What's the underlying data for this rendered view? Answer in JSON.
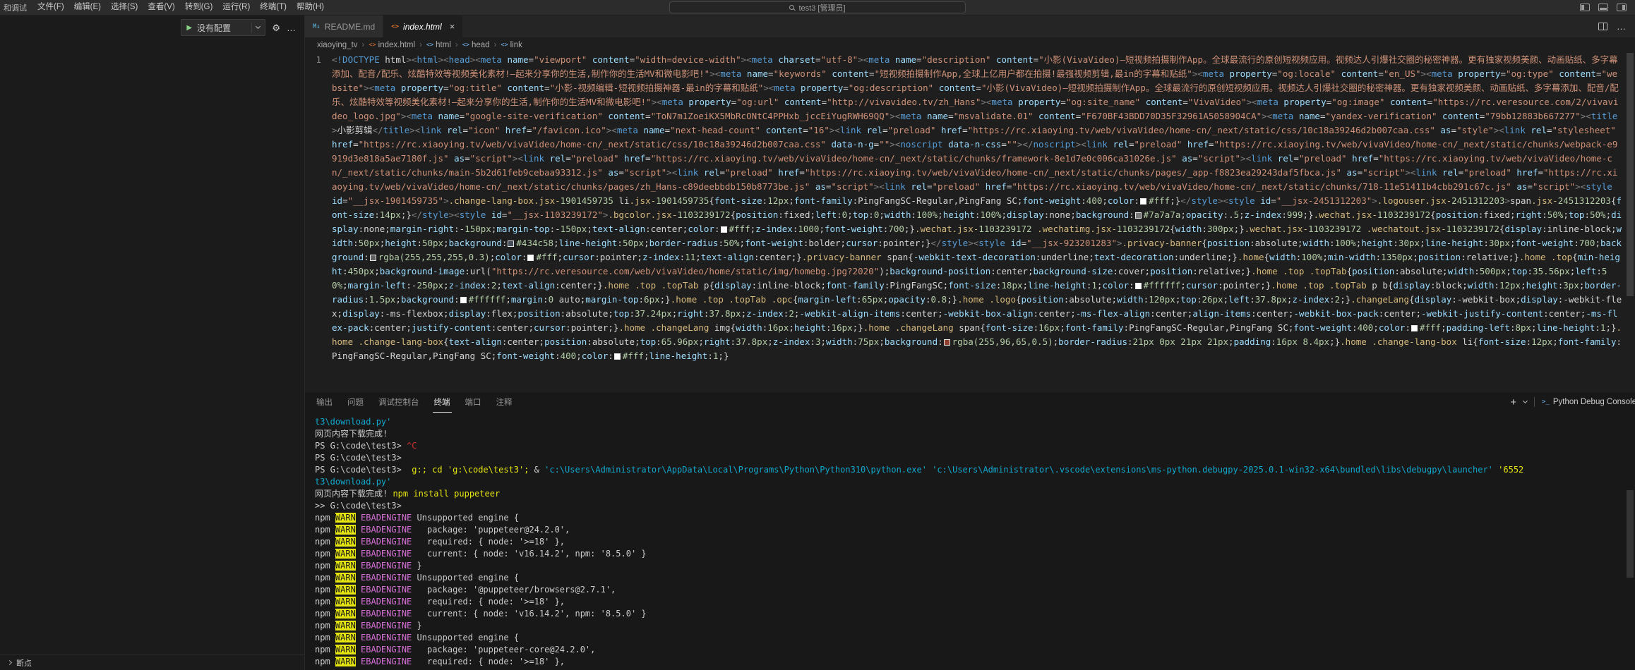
{
  "titlebar": {
    "sidebar_title_partial": "和调试",
    "menus": [
      "文件(F)",
      "编辑(E)",
      "选择(S)",
      "查看(V)",
      "转到(G)",
      "运行(R)",
      "终端(T)",
      "帮助(H)"
    ],
    "command_center": "test3 [管理员]"
  },
  "sidebar": {
    "run_config": "没有配置",
    "bottom_section": "断点"
  },
  "editor": {
    "tabs": [
      {
        "label": "README.md",
        "icon": "md",
        "active": false,
        "preview": false
      },
      {
        "label": "index.html",
        "icon": "html",
        "active": true,
        "preview": true
      }
    ],
    "breadcrumb": [
      "xiaoying_tv",
      "index.html",
      "html",
      "head",
      "link"
    ],
    "line_number": "1",
    "code": "<!DOCTYPE html><html><head><meta name=\"viewport\" content=\"width=device-width\"><meta charset=\"utf-8\"><meta name=\"description\" content=\"小影(VivaVideo)—短视频拍摄制作App。全球最流行的原创短视频应用。视频达人引爆社交圈的秘密神器。更有独家视频美颜、动画贴纸、多字幕添加、配音/配乐、炫酷特效等视频美化素材!—起来分享你的生活,制作你的生活MV和微电影吧!\"><meta name=\"keywords\" content=\"短视频拍摄制作App,全球上亿用户都在拍摄!最强视频剪辑,最in的字幕和贴纸\"><meta property=\"og:locale\" content=\"en_US\"><meta property=\"og:type\" content=\"website\"><meta property=\"og:title\" content=\"小影-视频编辑-短视频拍摄神器-最in的字幕和贴纸\"><meta property=\"og:description\" content=\"小影(VivaVideo)—短视频拍摄制作App。全球最流行的原创短视频应用。视频达人引爆社交圈的秘密神器。更有独家视频美颜、动画贴纸、多字幕添加、配音/配乐、炫酷特效等视频美化素材!—起来分享你的生活,制作你的生活MV和微电影吧!\"><meta property=\"og:url\" content=\"http://vivavideo.tv/zh_Hans\"><meta property=\"og:site_name\" content=\"VivaVideo\"><meta property=\"og:image\" content=\"https://rc.veresource.com/2/vivavideo_logo.jpg\"><meta name=\"google-site-verification\" content=\"ToN7m1ZoeiKX5MbRcONtC4PPHxb_jccEiYugRWH69QQ\"><meta name=\"msvalidate.01\" content=\"F670BF43BDD70D35F32961A5058904CA\"><meta name=\"yandex-verification\" content=\"79bb12883b667277\"><title>小影剪辑</title><link rel=\"icon\" href=\"/favicon.ico\"><meta name=\"next-head-count\" content=\"16\"><link rel=\"preload\" href=\"https://rc.xiaoying.tv/web/vivaVideo/home-cn/_next/static/css/10c18a39246d2b007caa.css\" as=\"style\"><link rel=\"stylesheet\" href=\"https://rc.xiaoying.tv/web/vivaVideo/home-cn/_next/static/css/10c18a39246d2b007caa.css\" data-n-g=\"\"><noscript data-n-css=\"\"></noscript><link rel=\"preload\" href=\"https://rc.xiaoying.tv/web/vivaVideo/home-cn/_next/static/chunks/webpack-e9919d3e818a5ae7180f.js\" as=\"script\"><link rel=\"preload\" href=\"https://rc.xiaoying.tv/web/vivaVideo/home-cn/_next/static/chunks/framework-8e1d7e0c006ca31026e.js\" as=\"script\"><link rel=\"preload\" href=\"https://rc.xiaoying.tv/web/vivaVideo/home-cn/_next/static/chunks/main-5b2d61feb9cebaa93312.js\" as=\"script\"><link rel=\"preload\" href=\"https://rc.xiaoying.tv/web/vivaVideo/home-cn/_next/static/chunks/pages/_app-f8823ea29243daf5fbca.js\" as=\"script\"><link rel=\"preload\" href=\"https://rc.xiaoying.tv/web/vivaVideo/home-cn/_next/static/chunks/pages/zh_Hans-c89deebbdb150b8773be.js\" as=\"script\"><link rel=\"preload\" href=\"https://rc.xiaoying.tv/web/vivaVideo/home-cn/_next/static/chunks/718-11e51411b4cbb291c67c.js\" as=\"script\"><style id=\"__jsx-1901459735\">.change-lang-box.jsx-1901459735 li.jsx-1901459735{font-size:12px;font-family:PingFangSC-Regular,PingFang SC;font-weight:400;color:#fff;}</style><style id=\"__jsx-2451312203\">.logouser.jsx-2451312203>span.jsx-2451312203{font-size:14px;}</style><style id=\"__jsx-1103239172\">.bgcolor.jsx-1103239172{position:fixed;left:0;top:0;width:100%;height:100%;display:none;background:#7a7a7a;opacity:.5;z-index:999;}.wechat.jsx-1103239172{position:fixed;right:50%;top:50%;display:none;margin-right:-150px;margin-top:-150px;text-align:center;color:#fff;z-index:1000;font-weight:700;}.wechat.jsx-1103239172 .wechatimg.jsx-1103239172{width:300px;}.wechat.jsx-1103239172 .wechatout.jsx-1103239172{display:inline-block;width:50px;height:50px;background:#434c58;line-height:50px;border-radius:50%;font-weight:bolder;cursor:pointer;}</style><style id=\"__jsx-923201283\">.privacy-banner{position:absolute;width:100%;height:30px;line-height:30px;font-weight:700;background:rgba(255,255,255,0.3);color:#fff;cursor:pointer;z-index:11;text-align:center;}.privacy-banner span{-webkit-text-decoration:underline;text-decoration:underline;}.home{width:100%;min-width:1350px;position:relative;}.home .top{min-height:450px;background-image:url(\"https://rc.veresource.com/web/vivaVideo/home/static/img/homebg.jpg?2020\");background-position:center;background-size:cover;position:relative;}.home .top .topTab{position:absolute;width:500px;top:35.56px;left:50%;margin-left:-250px;z-index:2;text-align:center;}.home .top .topTab p{display:inline-block;font-family:PingFangSC;font-size:18px;line-height:1;color:#ffffff;cursor:pointer;}.home .top .topTab p b{display:block;width:12px;height:3px;border-radius:1.5px;background:#ffffff;margin:0 auto;margin-top:6px;}.home .top .topTab .opc{margin-left:65px;opacity:0.8;}.home .logo{position:absolute;width:120px;top:26px;left:37.8px;z-index:2;}.changeLang{display:-webkit-box;display:-webkit-flex;display:-ms-flexbox;display:flex;position:absolute;top:37.24px;right:37.8px;z-index:2;-webkit-align-items:center;-webkit-box-align:center;-ms-flex-align:center;align-items:center;-webkit-box-pack:center;-webkit-justify-content:center;-ms-flex-pack:center;justify-content:center;cursor:pointer;}.home .changeLang img{width:16px;height:16px;}.home .changeLang span{font-size:16px;font-family:PingFangSC-Regular,PingFang SC;font-weight:400;color:#fff;padding-left:8px;line-height:1;}.home .change-lang-box{text-align:center;position:absolute;top:65.96px;right:37.8px;z-index:3;width:75px;background:rgba(255,96,65,0.5);border-radius:21px 0px 21px 21px;padding:16px 8.4px;}.home .change-lang-box li{font-size:12px;font-family:PingFangSC-Regular,PingFang SC;font-weight:400;color:#fff;line-height:1;}"
  },
  "panel": {
    "tabs": [
      "输出",
      "问题",
      "调试控制台",
      "终端",
      "端口",
      "注释"
    ],
    "active_tab": "终端",
    "terminal_list_item": "Python Debug Console",
    "terminal_lines": [
      [
        [
          "c",
          "t3\\download.py'"
        ]
      ],
      [
        [
          "d",
          "网页内容下载完成!"
        ]
      ],
      [
        [
          "d",
          "PS G:\\code\\test3> "
        ],
        [
          "r",
          "^C"
        ]
      ],
      [
        [
          "d",
          "PS G:\\code\\test3> "
        ]
      ],
      [
        [
          "d",
          "PS G:\\code\\test3>  "
        ],
        [
          "y",
          "g:; cd 'g:\\code\\test3'; "
        ],
        [
          "d",
          "& "
        ],
        [
          "c",
          "'c:\\Users\\Administrator\\AppData\\Local\\Programs\\Python\\Python310\\python.exe' "
        ],
        [
          "c",
          "'c:\\Users\\Administrator\\.vscode\\extensions\\ms-python.debugpy-2025.0.1-win32-x64\\bundled\\libs\\debugpy\\launcher' "
        ],
        [
          "y",
          "'6552"
        ]
      ],
      [
        [
          "c",
          "t3\\download.py'"
        ]
      ],
      [
        [
          "d",
          "网页内容下载完成! "
        ],
        [
          "y",
          "npm install puppeteer"
        ]
      ],
      [
        [
          "d",
          ">> G:\\code\\test3>"
        ]
      ],
      [
        [
          "d",
          "npm "
        ],
        [
          "w",
          "WARN"
        ],
        [
          "m",
          " EBADENGINE"
        ],
        [
          "d",
          " Unsupported engine {"
        ]
      ],
      [
        [
          "d",
          "npm "
        ],
        [
          "w",
          "WARN"
        ],
        [
          "m",
          " EBADENGINE"
        ],
        [
          "d",
          "   package: 'puppeteer@24.2.0',"
        ]
      ],
      [
        [
          "d",
          "npm "
        ],
        [
          "w",
          "WARN"
        ],
        [
          "m",
          " EBADENGINE"
        ],
        [
          "d",
          "   required: { node: '>=18' },"
        ]
      ],
      [
        [
          "d",
          "npm "
        ],
        [
          "w",
          "WARN"
        ],
        [
          "m",
          " EBADENGINE"
        ],
        [
          "d",
          "   current: { node: 'v16.14.2', npm: '8.5.0' }"
        ]
      ],
      [
        [
          "d",
          "npm "
        ],
        [
          "w",
          "WARN"
        ],
        [
          "m",
          " EBADENGINE"
        ],
        [
          "d",
          " }"
        ]
      ],
      [
        [
          "d",
          "npm "
        ],
        [
          "w",
          "WARN"
        ],
        [
          "m",
          " EBADENGINE"
        ],
        [
          "d",
          " Unsupported engine {"
        ]
      ],
      [
        [
          "d",
          "npm "
        ],
        [
          "w",
          "WARN"
        ],
        [
          "m",
          " EBADENGINE"
        ],
        [
          "d",
          "   package: '@puppeteer/browsers@2.7.1',"
        ]
      ],
      [
        [
          "d",
          "npm "
        ],
        [
          "w",
          "WARN"
        ],
        [
          "m",
          " EBADENGINE"
        ],
        [
          "d",
          "   required: { node: '>=18' },"
        ]
      ],
      [
        [
          "d",
          "npm "
        ],
        [
          "w",
          "WARN"
        ],
        [
          "m",
          " EBADENGINE"
        ],
        [
          "d",
          "   current: { node: 'v16.14.2', npm: '8.5.0' }"
        ]
      ],
      [
        [
          "d",
          "npm "
        ],
        [
          "w",
          "WARN"
        ],
        [
          "m",
          " EBADENGINE"
        ],
        [
          "d",
          " }"
        ]
      ],
      [
        [
          "d",
          "npm "
        ],
        [
          "w",
          "WARN"
        ],
        [
          "m",
          " EBADENGINE"
        ],
        [
          "d",
          " Unsupported engine {"
        ]
      ],
      [
        [
          "d",
          "npm "
        ],
        [
          "w",
          "WARN"
        ],
        [
          "m",
          " EBADENGINE"
        ],
        [
          "d",
          "   package: 'puppeteer-core@24.2.0',"
        ]
      ],
      [
        [
          "d",
          "npm "
        ],
        [
          "w",
          "WARN"
        ],
        [
          "m",
          " EBADENGINE"
        ],
        [
          "d",
          "   required: { node: '>=18' },"
        ]
      ]
    ]
  },
  "icons": {
    "search": "magnifier",
    "play": "▶",
    "gear": "⚙",
    "more": "…",
    "close": "×",
    "plus": "+",
    "chevron_down": "v",
    "breadcrumb_symbol": "<>"
  },
  "colors": {
    "string": "#ce9178",
    "tag": "#569cd6",
    "attribute": "#9cdcfe",
    "number": "#b5cea8",
    "selector": "#d7ba7d",
    "terminal_yellow": "#e5e510",
    "terminal_cyan": "#11a8cd",
    "terminal_red": "#cd3131",
    "terminal_magenta": "#d670d6",
    "warn_badge_bg": "#e5e510",
    "play_green": "#89d185"
  }
}
